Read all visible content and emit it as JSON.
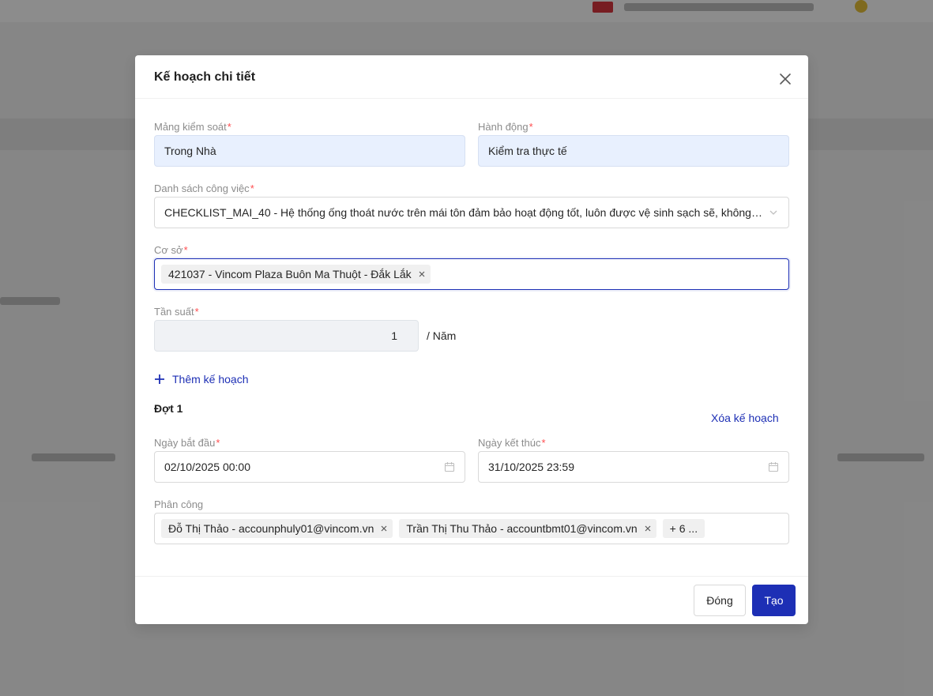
{
  "modal": {
    "title": "Kế hoạch chi tiết",
    "fields": {
      "control_area": {
        "label": "Mảng kiểm soát",
        "value": "Trong Nhà"
      },
      "action": {
        "label": "Hành động",
        "value": "Kiểm tra thực tế"
      },
      "task_list": {
        "label": "Danh sách công việc",
        "value": "CHECKLIST_MAI_40 - Hệ thống ống thoát nước trên mái tôn đảm bảo hoạt động tốt, luôn được vệ sinh sạch sẽ, không có..."
      },
      "facility": {
        "label": "Cơ sở",
        "tags": [
          "421037 - Vincom Plaza Buôn Ma Thuột - Đắk Lắk"
        ]
      },
      "frequency": {
        "label": "Tần suất",
        "value": "1",
        "unit": "/ Năm"
      }
    },
    "add_plan_label": "Thêm kế hoạch",
    "round": {
      "title": "Đợt 1",
      "delete_label": "Xóa kế hoạch",
      "start_date": {
        "label": "Ngày bắt đầu",
        "value": "02/10/2025 00:00"
      },
      "end_date": {
        "label": "Ngày kết thúc",
        "value": "31/10/2025 23:59"
      },
      "assignment": {
        "label": "Phân công",
        "tags": [
          "Đỗ Thị Thảo - accounphuly01@vincom.vn",
          "Trần Thị Thu Thảo - accountbmt01@vincom.vn"
        ],
        "more": "+ 6 ..."
      }
    },
    "footer": {
      "close_label": "Đóng",
      "create_label": "Tạo"
    }
  },
  "colors": {
    "primary": "#1d2fb5",
    "required": "#ff4d4f",
    "label": "#8c8c8c"
  }
}
